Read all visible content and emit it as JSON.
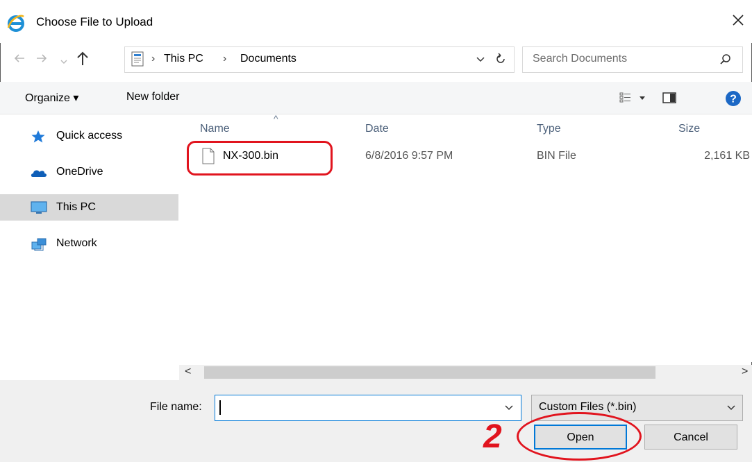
{
  "window": {
    "title": "Choose File to Upload",
    "app_icon": "internet-explorer-icon"
  },
  "navigation": {
    "breadcrumb": [
      "This PC",
      "Documents"
    ],
    "breadcrumb_separator": "›",
    "search_placeholder": "Search Documents"
  },
  "toolbar": {
    "organize_label": "Organize ▾",
    "new_folder_label": "New folder"
  },
  "sidebar": {
    "items": [
      {
        "label": "Quick access",
        "icon": "star-icon",
        "selected": false
      },
      {
        "label": "OneDrive",
        "icon": "cloud-icon",
        "selected": false
      },
      {
        "label": "This PC",
        "icon": "monitor-icon",
        "selected": true
      },
      {
        "label": "Network",
        "icon": "network-icon",
        "selected": false
      }
    ]
  },
  "file_list": {
    "columns": [
      "Name",
      "Date",
      "Type",
      "Size"
    ],
    "sort_column": "Name",
    "rows": [
      {
        "name": "NX-300.bin",
        "date": "6/8/2016 9:57 PM",
        "type": "BIN File",
        "size": "2,161 KB"
      }
    ]
  },
  "footer": {
    "file_name_label": "File name:",
    "file_name_value": "",
    "file_type_selected": "Custom Files (*.bin)",
    "open_label": "Open",
    "cancel_label": "Cancel"
  },
  "annotation": {
    "step_number": "2",
    "color": "#e1141e"
  },
  "colors": {
    "accent": "#0078d7",
    "selection": "#d9d9d9",
    "header_text": "#4c607a"
  }
}
